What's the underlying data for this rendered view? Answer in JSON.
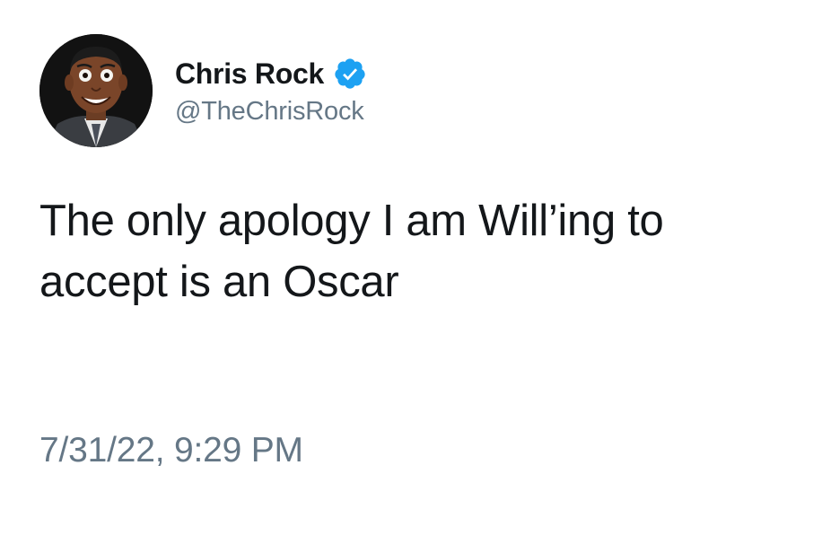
{
  "author": {
    "display_name": "Chris Rock",
    "handle": "@TheChrisRock",
    "verified": true,
    "verified_icon": "verified-badge-icon",
    "avatar_icon": "profile-avatar"
  },
  "tweet": {
    "text_line_1": "The only apology I am Will’ing to",
    "text_line_2": "accept is an Oscar",
    "timestamp": "7/31/22, 9:29 PM"
  },
  "colors": {
    "text_primary": "#14171a",
    "text_secondary": "#657786",
    "verified_blue": "#1da1f2",
    "background": "#ffffff"
  }
}
